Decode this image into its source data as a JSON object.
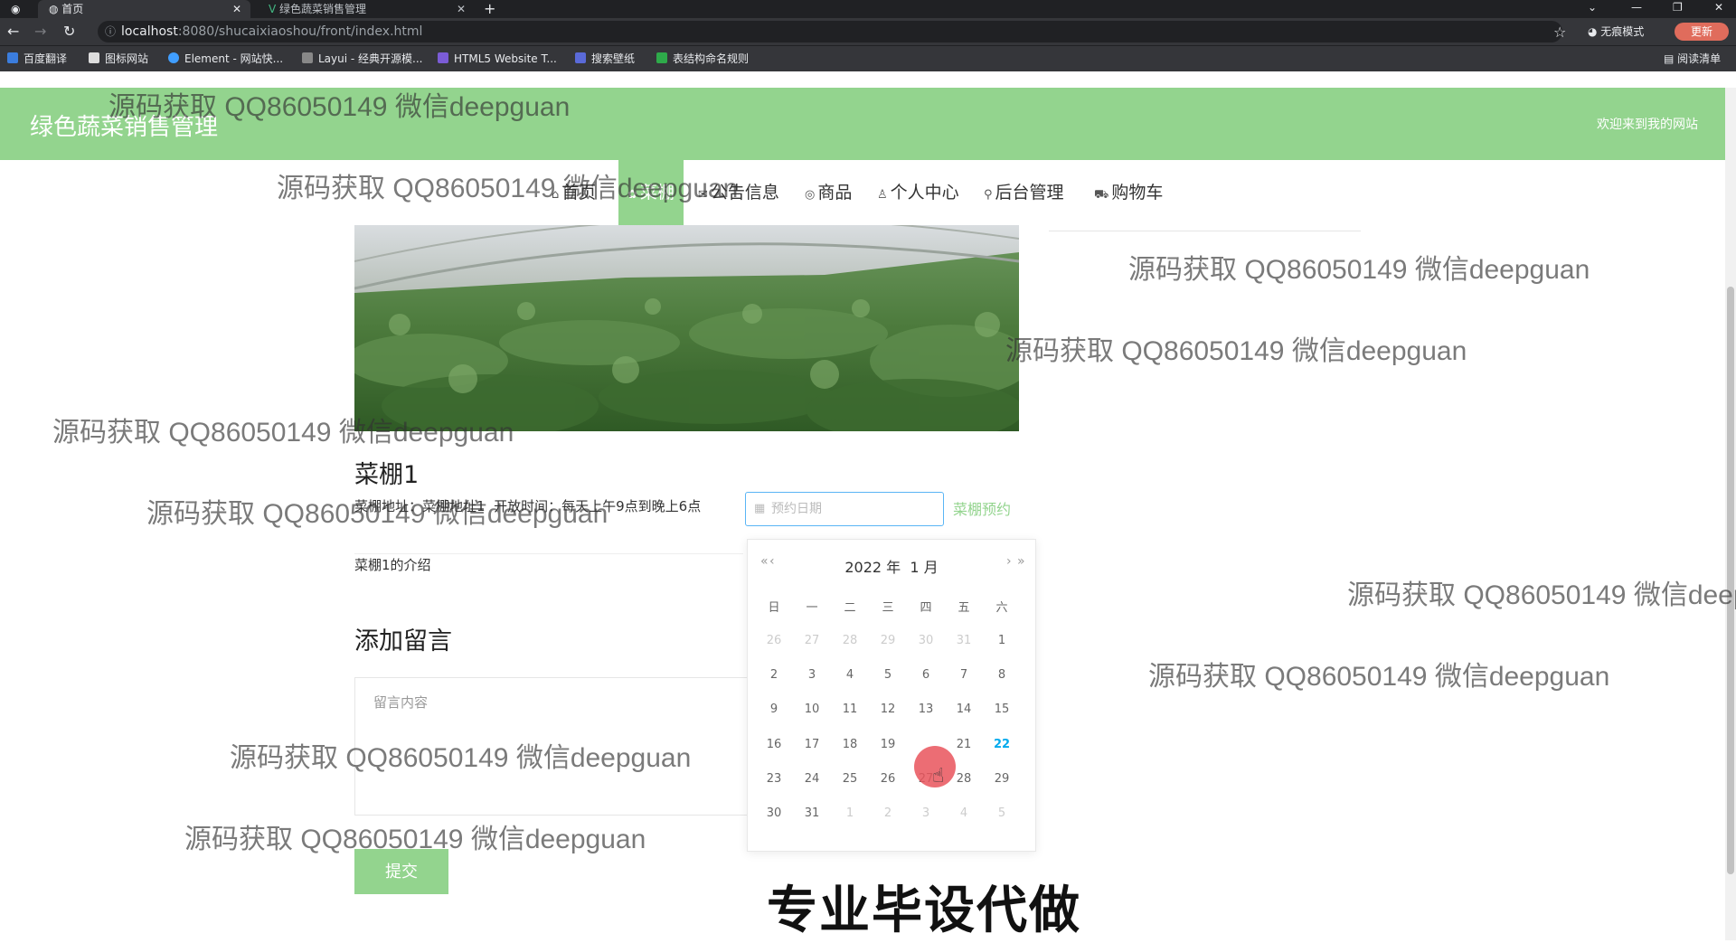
{
  "browser": {
    "tabs": [
      {
        "label": "首页",
        "active": true
      },
      {
        "label": "绿色蔬菜销售管理",
        "active": false
      }
    ],
    "url_host": "localhost",
    "url_path": ":8080/shucaixiaoshou/front/index.html",
    "incognito_label": "无痕模式",
    "update_label": "更新",
    "bookmarks": [
      "百度翻译",
      "图标网站",
      "Element - 网站快...",
      "Layui - 经典开源模...",
      "HTML5 Website T...",
      "搜索壁纸",
      "表结构命名规则"
    ],
    "reading_list": "阅读清单"
  },
  "site": {
    "title": "绿色蔬菜销售管理",
    "welcome": "欢迎来到我的网站"
  },
  "nav": [
    {
      "icon": "home-icon",
      "glyph": "⌂",
      "label": "首页"
    },
    {
      "icon": "greenhouse-icon",
      "glyph": "✿",
      "label": "菜棚",
      "active": true
    },
    {
      "icon": "notice-icon",
      "glyph": "✉",
      "label": "公告信息"
    },
    {
      "icon": "goods-icon",
      "glyph": "◎",
      "label": "商品"
    },
    {
      "icon": "user-icon",
      "glyph": "♙",
      "label": "个人中心"
    },
    {
      "icon": "link-icon",
      "glyph": "⚲",
      "label": "后台管理"
    },
    {
      "icon": "cart-icon",
      "glyph": "⛟",
      "label": "购物车"
    }
  ],
  "detail": {
    "title": "菜棚1",
    "meta_prefix": "菜棚地址：",
    "meta_address": "菜棚地址1",
    "meta_hours_label": "开放时间：",
    "meta_hours": "每天上午9点到晚上6点",
    "date_placeholder": "预约日期",
    "reserve_label": "菜棚预约",
    "intro": "菜棚1的介绍"
  },
  "comment": {
    "heading": "添加留言",
    "placeholder": "留言内容",
    "submit_label": "提交"
  },
  "calendar": {
    "year": "2022 年",
    "month": "1 月",
    "prev_year": "«",
    "prev_month": "‹",
    "next_month": "›",
    "next_year": "»",
    "weekdays": [
      "日",
      "一",
      "二",
      "三",
      "四",
      "五",
      "六"
    ],
    "rows": [
      [
        "26",
        "27",
        "28",
        "29",
        "30",
        "31",
        "1"
      ],
      [
        "2",
        "3",
        "4",
        "5",
        "6",
        "7",
        "8"
      ],
      [
        "9",
        "10",
        "11",
        "12",
        "13",
        "14",
        "15"
      ],
      [
        "16",
        "17",
        "18",
        "19",
        "20",
        "21",
        "22"
      ],
      [
        "23",
        "24",
        "25",
        "26",
        "27",
        "28",
        "29"
      ],
      [
        "30",
        "31",
        "1",
        "2",
        "3",
        "4",
        "5"
      ]
    ],
    "today": "22",
    "hovered": "20"
  },
  "overlay": {
    "watermark": "源码获取 QQ86050149 微信deepguan",
    "promo": "专业毕设代做"
  },
  "colors": {
    "brand_green": "#93d48e",
    "today_blue": "#01aaed",
    "hover_red": "#e9545c"
  }
}
